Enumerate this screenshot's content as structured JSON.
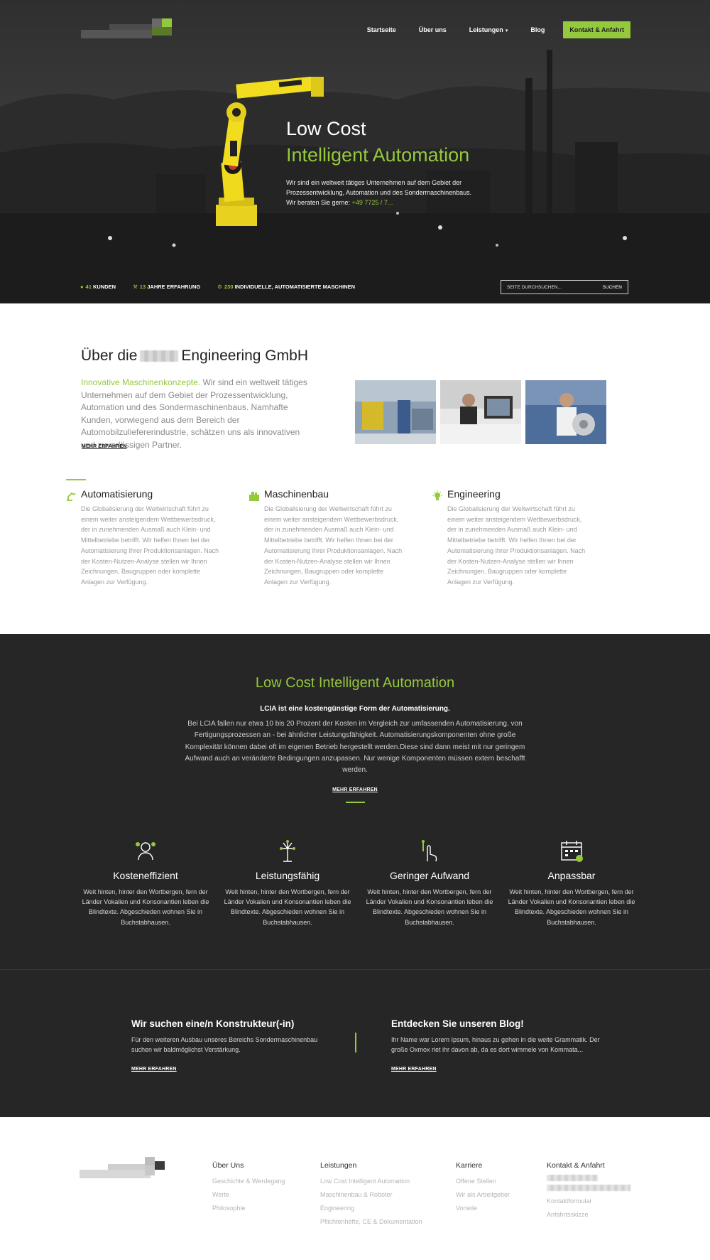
{
  "nav": {
    "items": [
      {
        "label": "Startseite"
      },
      {
        "label": "Über uns"
      },
      {
        "label": "Leistungen",
        "caret": "▾"
      },
      {
        "label": "Blog"
      }
    ],
    "cta": "Kontakt & Anfahrt"
  },
  "hero": {
    "title1": "Low Cost",
    "title2": "Intelligent Automation",
    "text": "Wir sind ein weltweit tätiges Unternehmen auf dem Gebiet der Prozessentwicklung, Automation und des Sondermaschinenbaus.",
    "consult": "Wir beraten Sie gerne:",
    "phone": "+49 7725 / 7..."
  },
  "stats": [
    {
      "icon": "user-icon",
      "num": "41",
      "label": "KUNDEN"
    },
    {
      "icon": "wrench-icon",
      "num": "13",
      "label": "JAHRE ERFAHRUNG"
    },
    {
      "icon": "gear-icon",
      "num": "230",
      "label": "INDIVIDUELLE, AUTOMATISIERTE MASCHINEN"
    }
  ],
  "search": {
    "placeholder": "SEITE DURCHSUCHEN...",
    "button": "SUCHEN"
  },
  "about": {
    "title_pre": "Über die",
    "title_post": "Engineering GmbH",
    "highlight": "Innovative Maschinenkonzepte.",
    "text": " Wir sind ein weltweit tätiges Unternehmen auf dem Gebiet der Prozessentwicklung, Automation und des Sondermaschinenbaus. Namhafte Kunden, vorwiegend aus dem Bereich der Automobilzuliefererindustrie, schätzen uns als innovativen und zuverlässigen Partner.",
    "more": "MEHR ERFAHREN"
  },
  "services": [
    {
      "icon": "robot-arm-icon",
      "title": "Automatisierung",
      "text": "Die Globalisierung der Weltwirtschaft führt zu einem weiter ansteigendem Wettbewerbsdruck, der in zunehmenden Ausmaß auch Klein- und Mittelbetriebe betrifft. Wir helfen Ihnen bei der Automatisierung Ihrer Produktionsanlagen. Nach der Kosten-Nutzen-Analyse stellen wir Ihnen Zeichnungen, Baugruppen oder komplette Anlagen zur Verfügung."
    },
    {
      "icon": "machine-icon",
      "title": "Maschinenbau",
      "text": "Die Globalisierung der Weltwirtschaft führt zu einem weiter ansteigendem Wettbewerbsdruck, der in zunehmenden Ausmaß auch Klein- und Mittelbetriebe betrifft. Wir helfen Ihnen bei der Automatisierung Ihrer Produktionsanlagen. Nach der Kosten-Nutzen-Analyse stellen wir Ihnen Zeichnungen, Baugruppen oder komplette Anlagen zur Verfügung."
    },
    {
      "icon": "lightbulb-icon",
      "title": "Engineering",
      "text": "Die Globalisierung der Weltwirtschaft führt zu einem weiter ansteigendem Wettbewerbsdruck, der in zunehmenden Ausmaß auch Klein- und Mittelbetriebe betrifft. Wir helfen Ihnen bei der Automatisierung Ihrer Produktionsanlagen. Nach der Kosten-Nutzen-Analyse stellen wir Ihnen Zeichnungen, Baugruppen oder komplette Anlagen zur Verfügung."
    }
  ],
  "lcia": {
    "title": "Low Cost Intelligent Automation",
    "subtitle": "LCIA ist eine kostengünstige Form der Automatisierung.",
    "text": "Bei LCIA fallen nur etwa 10 bis 20 Prozent der Kosten im Vergleich zur umfassenden Automatisierung. von Fertigungsprozessen an - bei ähnlicher Leistungsfähigkeit. Automatisierungskomponenten ohne große Komplexität können dabei oft im eigenen Betrieb hergestellt werden.Diese sind dann meist mit nur geringem Aufwand auch an veränderte Bedingungen anzupassen. Nur wenige Komponenten müssen extern beschafft werden.",
    "more": "MEHR ERFAHREN"
  },
  "features": [
    {
      "icon": "person-money-icon",
      "title": "Kosteneffizient",
      "text": "Weit hinten, hinter den Wortbergen, fern der Länder Vokalien und Konsonantien leben die Blindtexte. Abgeschieden wohnen Sie in Buchstabhausen."
    },
    {
      "icon": "firework-icon",
      "title": "Leistungsfähig",
      "text": "Weit hinten, hinter den Wortbergen, fern der Länder Vokalien und Konsonantien leben die Blindtexte. Abgeschieden wohnen Sie in Buchstabhausen."
    },
    {
      "icon": "touch-hand-icon",
      "title": "Geringer Aufwand",
      "text": "Weit hinten, hinter den Wortbergen, fern der Länder Vokalien und Konsonantien leben die Blindtexte. Abgeschieden wohnen Sie in Buchstabhausen."
    },
    {
      "icon": "calendar-icon",
      "title": "Anpassbar",
      "text": "Weit hinten, hinter den Wortbergen, fern der Länder Vokalien und Konsonantien leben die Blindtexte. Abgeschieden wohnen Sie in Buchstabhausen."
    }
  ],
  "cta": {
    "job_title": "Wir suchen eine/n Konstrukteur(-in)",
    "job_text": "Für den weiteren Ausbau unseres Bereichs Sondermaschinenbau suchen wir baldmöglichst Verstärkung.",
    "job_more": "MEHR ERFAHREN",
    "blog_title": "Entdecken Sie unseren Blog!",
    "blog_text": "Ihr Name war Lorem Ipsum, hinaus zu gehen in die weite Grammatik. Der große Oxmox riet ihr davon ab, da es dort wimmele von Kommata...",
    "blog_more": "MEHR ERFAHREN"
  },
  "footer": {
    "col1": {
      "title": "Über Uns",
      "links": [
        "Geschichte & Werdegang",
        "Werte",
        "Philosophie"
      ]
    },
    "col2": {
      "title": "Leistungen",
      "links": [
        "Low Cost Intelligent Automation",
        "Maschinenbau & Roboter",
        "Engineering",
        "Pflichtenhefte, CE & Dokumentation"
      ]
    },
    "col3": {
      "title": "Karriere",
      "links": [
        "Offene Stellen",
        "Wir als Arbeitgeber",
        "Vorteile"
      ]
    },
    "col4": {
      "title": "Kontakt & Anfahrt",
      "links": [
        "Kontaktformular",
        "Anfahrtsskizze"
      ]
    }
  },
  "colors": {
    "accent": "#94c83d",
    "dark": "#262626"
  }
}
